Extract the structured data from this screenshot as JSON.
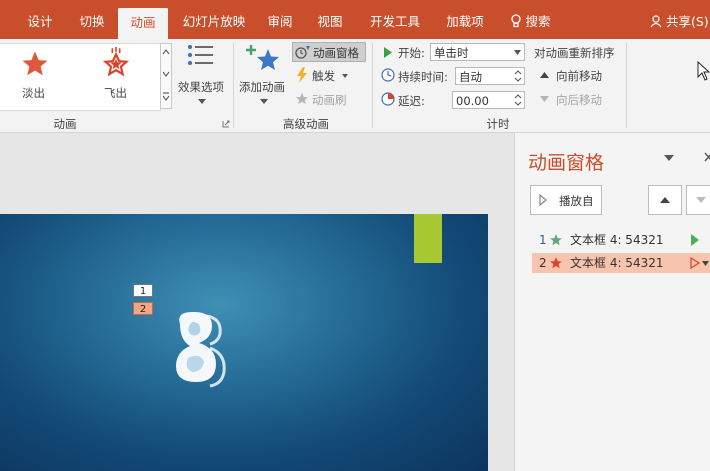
{
  "tabs": [
    {
      "label": "设计"
    },
    {
      "label": "切换"
    },
    {
      "label": "动画",
      "active": true
    },
    {
      "label": "幻灯片放映"
    },
    {
      "label": "审阅"
    },
    {
      "label": "视图"
    },
    {
      "label": "开发工具"
    },
    {
      "label": "加载项"
    }
  ],
  "search_label": "搜索",
  "share_label": "共享(S)",
  "ribbon": {
    "animation_gallery": [
      {
        "label": "淡出",
        "color": "#d9452c"
      },
      {
        "label": "飞出",
        "color": "#d9452c"
      }
    ],
    "effect_options": "效果选项",
    "animation_group_label": "动画",
    "add_animation": "添加动画",
    "animation_pane": "动画窗格",
    "trigger": "触发",
    "animation_painter": "动画刷",
    "advanced_group_label": "高级动画",
    "start_label": "开始:",
    "start_value": "单击时",
    "duration_label": "持续时间:",
    "duration_value": "自动",
    "delay_label": "延迟:",
    "delay_value": "00.00",
    "timing_group_label": "计时",
    "reorder_title": "对动画重新排序",
    "move_earlier": "向前移动",
    "move_later": "向后移动"
  },
  "slide": {
    "markers": [
      "1",
      "2"
    ],
    "accent_green": "#a9c933"
  },
  "pane": {
    "title": "动画窗格",
    "play_from": "播放自",
    "items": [
      {
        "num": "1",
        "text": "文本框 4: 54321",
        "star_color": "#62a77e",
        "selected": false
      },
      {
        "num": "2",
        "text": "文本框 4: 54321",
        "star_color": "#d9452c",
        "selected": true
      }
    ]
  },
  "colors": {
    "brand": "#c94f2c",
    "selected_row": "#f7c4ad"
  }
}
